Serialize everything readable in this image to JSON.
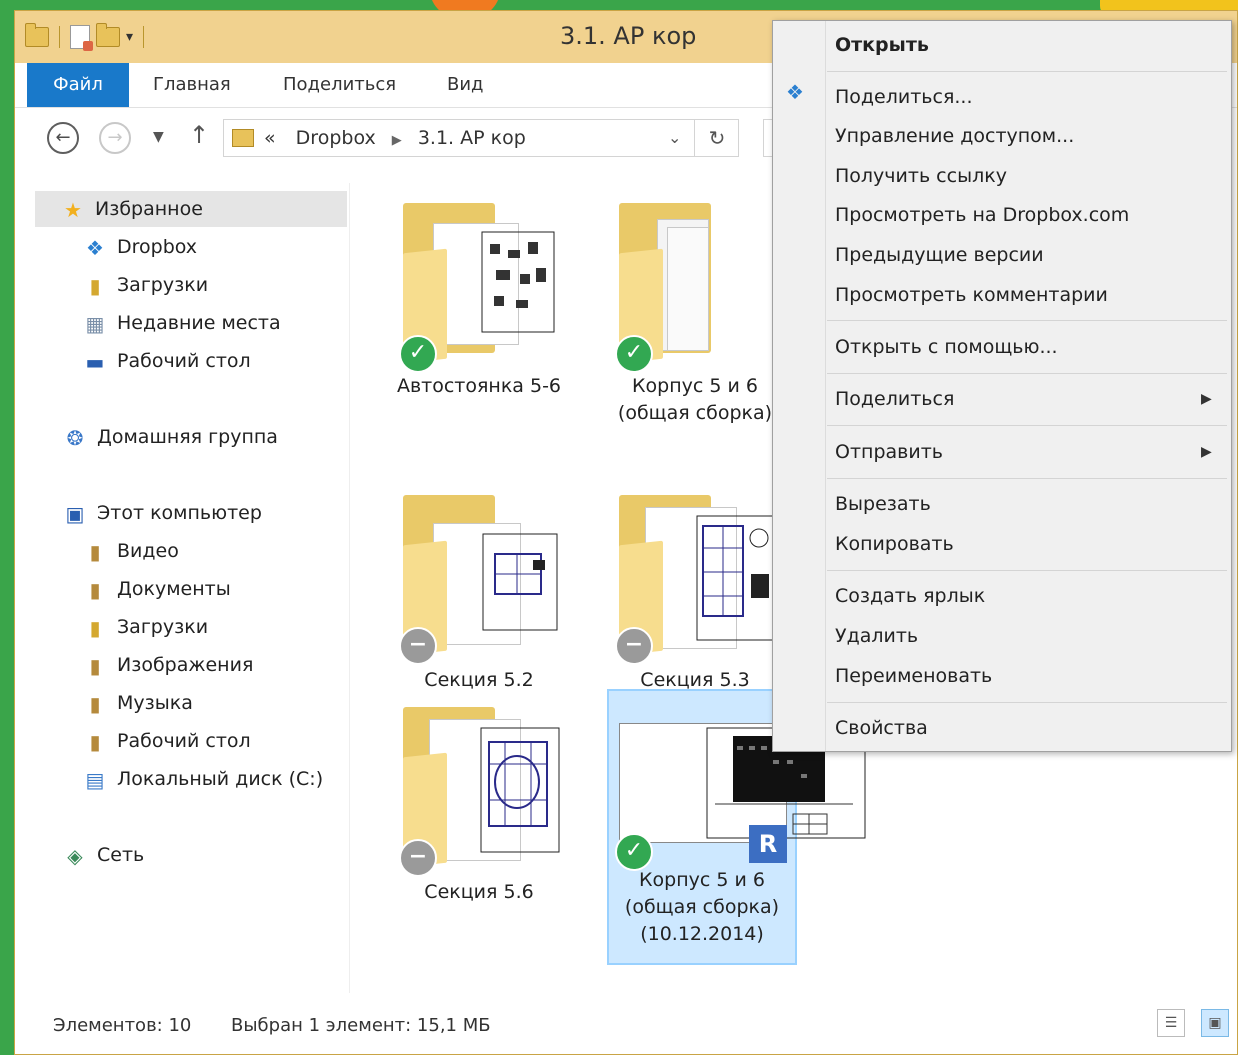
{
  "window": {
    "title": "3.1. АР кор"
  },
  "ribbon": {
    "tabs": [
      "Файл",
      "Главная",
      "Поделиться",
      "Вид"
    ]
  },
  "address": {
    "chevron": "«",
    "crumbs": [
      "Dropbox",
      "3.1. АР кор"
    ]
  },
  "sidebar": {
    "favorites": "Избранное",
    "fav_items": [
      "Dropbox",
      "Загрузки",
      "Недавние места",
      "Рабочий стол"
    ],
    "homegroup": "Домашняя группа",
    "computer": "Этот компьютер",
    "pc_items": [
      "Видео",
      "Документы",
      "Загрузки",
      "Изображения",
      "Музыка",
      "Рабочий стол",
      "Локальный диск (C:)"
    ],
    "network": "Сеть"
  },
  "items": [
    {
      "line1": "Автостоянка 5-6",
      "line2": "",
      "line3": "",
      "status": "synced"
    },
    {
      "line1": "Корпус 5 и 6",
      "line2": "(общая сборка)",
      "line3": "",
      "status": "synced"
    },
    {
      "line1": "Секция 5.2",
      "line2": "",
      "line3": "",
      "status": "not-synced"
    },
    {
      "line1": "Секция 5.3",
      "line2": "",
      "line3": "",
      "status": "not-synced"
    },
    {
      "line1": "Секция 5.6",
      "line2": "",
      "line3": "",
      "status": "not-synced"
    },
    {
      "line1": "Корпус 5 и 6",
      "line2": "(общая сборка)",
      "line3": "(10.12.2014)",
      "status": "synced",
      "selected": true
    }
  ],
  "status": {
    "count": "Элементов: 10",
    "selected": "Выбран 1 элемент: 15,1 МБ"
  },
  "context_menu": {
    "open": "Открыть",
    "share_dropbox": "Поделиться...",
    "manage_access": "Управление доступом...",
    "get_link": "Получить ссылку",
    "view_on_dropbox": "Просмотреть на Dropbox.com",
    "previous_versions": "Предыдущие версии",
    "view_comments": "Просмотреть комментарии",
    "open_with": "Открыть с помощью...",
    "share": "Поделиться",
    "send_to": "Отправить",
    "cut": "Вырезать",
    "copy": "Копировать",
    "create_shortcut": "Создать ярлык",
    "delete": "Удалить",
    "rename": "Переименовать",
    "properties": "Свойства"
  },
  "colors": {
    "file_tab": "#1979ca",
    "title_bar": "#f1d28f",
    "selection": "#cde8ff",
    "synced_badge": "#32a852"
  }
}
